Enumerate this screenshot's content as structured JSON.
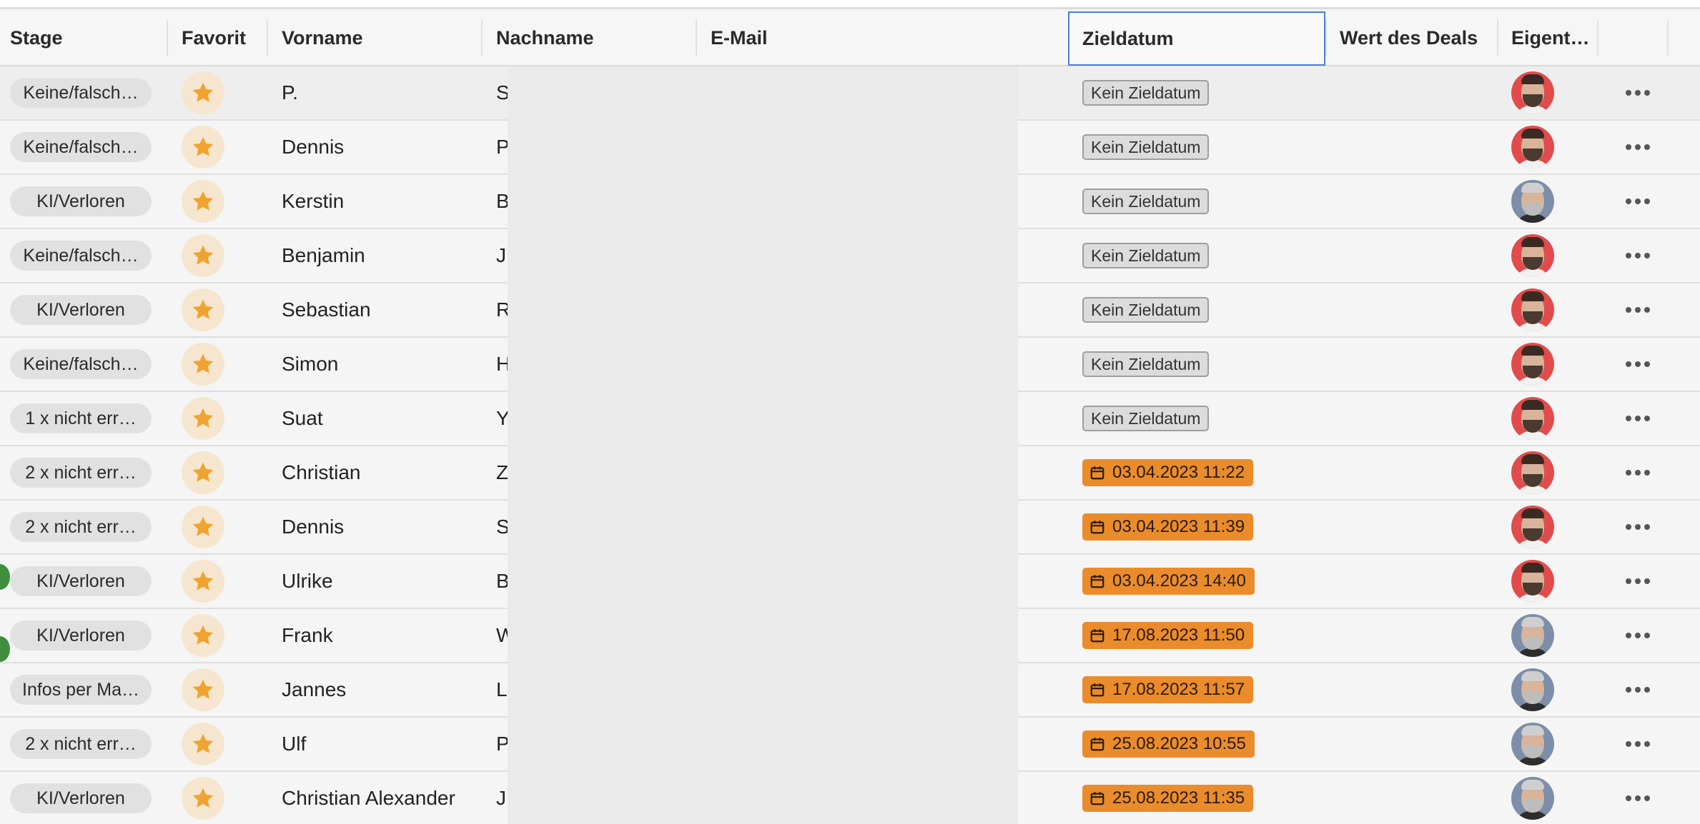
{
  "columns": {
    "stage": "Stage",
    "favorit": "Favorit",
    "vorname": "Vorname",
    "nachname": "Nachname",
    "email": "E-Mail",
    "zieldatum": "Zieldatum",
    "wert": "Wert des Deals",
    "eigentuemer": "Eigent…"
  },
  "rows": [
    {
      "stage": "Keine/falsch…",
      "vorname": "P.",
      "nachname_initial": "S",
      "ziel": "Kein Zieldatum",
      "ziel_type": "none",
      "owner": "avatar-a"
    },
    {
      "stage": "Keine/falsch…",
      "vorname": "Dennis",
      "nachname_initial": "P",
      "ziel": "Kein Zieldatum",
      "ziel_type": "none",
      "owner": "avatar-a"
    },
    {
      "stage": "KI/Verloren",
      "vorname": "Kerstin",
      "nachname_initial": "B",
      "ziel": "Kein Zieldatum",
      "ziel_type": "none",
      "owner": "avatar-b"
    },
    {
      "stage": "Keine/falsch…",
      "vorname": "Benjamin",
      "nachname_initial": "J",
      "ziel": "Kein Zieldatum",
      "ziel_type": "none",
      "owner": "avatar-a"
    },
    {
      "stage": "KI/Verloren",
      "vorname": "Sebastian",
      "nachname_initial": "R",
      "ziel": "Kein Zieldatum",
      "ziel_type": "none",
      "owner": "avatar-a"
    },
    {
      "stage": "Keine/falsch…",
      "vorname": "Simon",
      "nachname_initial": "H",
      "ziel": "Kein Zieldatum",
      "ziel_type": "none",
      "owner": "avatar-a"
    },
    {
      "stage": "1 x nicht err…",
      "vorname": "Suat",
      "nachname_initial": "Y",
      "ziel": "Kein Zieldatum",
      "ziel_type": "none",
      "owner": "avatar-a"
    },
    {
      "stage": "2 x nicht err…",
      "vorname": "Christian",
      "nachname_initial": "Z",
      "ziel": "03.04.2023 11:22",
      "ziel_type": "date",
      "owner": "avatar-a"
    },
    {
      "stage": "2 x nicht err…",
      "vorname": "Dennis",
      "nachname_initial": "S",
      "ziel": "03.04.2023 11:39",
      "ziel_type": "date",
      "owner": "avatar-a"
    },
    {
      "stage": "KI/Verloren",
      "vorname": "Ulrike",
      "nachname_initial": "B",
      "ziel": "03.04.2023 14:40",
      "ziel_type": "date",
      "owner": "avatar-a"
    },
    {
      "stage": "KI/Verloren",
      "vorname": "Frank",
      "nachname_initial": "W",
      "ziel": "17.08.2023 11:50",
      "ziel_type": "date",
      "owner": "avatar-b"
    },
    {
      "stage": "Infos per Ma…",
      "vorname": "Jannes",
      "nachname_initial": "L",
      "ziel": "17.08.2023 11:57",
      "ziel_type": "date",
      "owner": "avatar-b"
    },
    {
      "stage": "2 x nicht err…",
      "vorname": "Ulf",
      "nachname_initial": "P",
      "ziel": "25.08.2023 10:55",
      "ziel_type": "date",
      "owner": "avatar-b"
    },
    {
      "stage": "KI/Verloren",
      "vorname": "Christian Alexander",
      "nachname_initial": "J",
      "ziel": "25.08.2023 11:35",
      "ziel_type": "date",
      "owner": "avatar-b"
    }
  ],
  "colors": {
    "accent_date_badge": "#ea8c2c",
    "favorite_star": "#f0a330",
    "selected_header_border": "#4a7fd8",
    "status_dot": "#3e8e3e"
  },
  "icons": {
    "favorite": "star-icon",
    "date": "calendar-icon",
    "row_menu": "more-horizontal-icon"
  }
}
